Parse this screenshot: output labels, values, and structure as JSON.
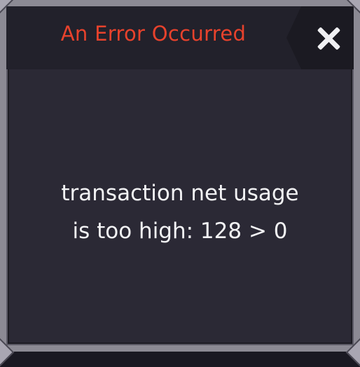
{
  "dialog": {
    "title": "An Error Occurred",
    "message_line1": "transaction net usage",
    "message_line2": "is too high: 128 > 0",
    "close_icon": "close-x-icon",
    "colors": {
      "title": "#e8422c",
      "panel": "#2b2935",
      "header": "#22212b",
      "frame": "#8c8a94",
      "text": "#f3f3f5"
    }
  }
}
